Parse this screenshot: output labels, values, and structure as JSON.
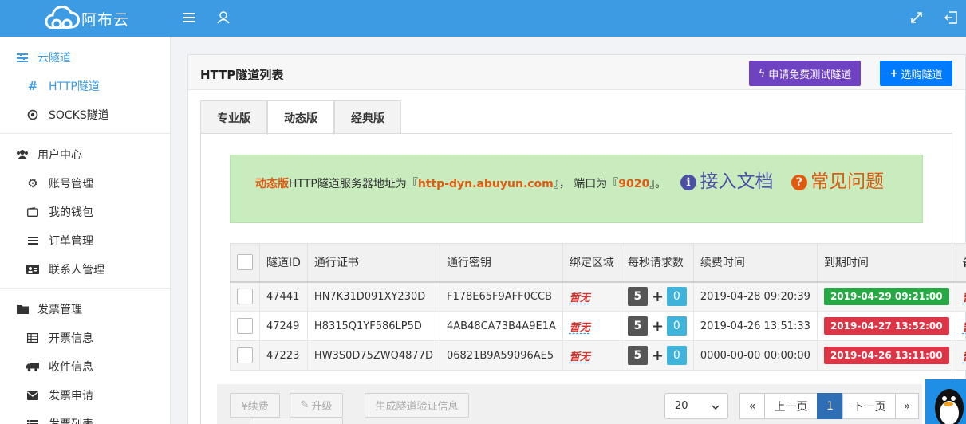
{
  "header": {
    "logo_text": "阿布云"
  },
  "sidebar": {
    "groups": [
      {
        "items": [
          {
            "label": "云隧道",
            "level": "top",
            "icon": "sliders-icon",
            "active": true
          },
          {
            "label": "HTTP隧道",
            "level": "sub",
            "icon": "hash-icon",
            "active": true
          },
          {
            "label": "SOCKS隧道",
            "level": "sub",
            "icon": "dot-circle-icon"
          }
        ]
      },
      {
        "items": [
          {
            "label": "用户中心",
            "level": "top",
            "icon": "users-icon"
          },
          {
            "label": "账号管理",
            "level": "sub",
            "icon": "gear-icon"
          },
          {
            "label": "我的钱包",
            "level": "sub",
            "icon": "wallet-icon"
          },
          {
            "label": "订单管理",
            "level": "sub",
            "icon": "list-icon"
          },
          {
            "label": "联系人管理",
            "level": "sub",
            "icon": "id-card-icon"
          }
        ]
      },
      {
        "items": [
          {
            "label": "发票管理",
            "level": "top",
            "icon": "folder-icon"
          },
          {
            "label": "开票信息",
            "level": "sub",
            "icon": "table-icon"
          },
          {
            "label": "收件信息",
            "level": "sub",
            "icon": "truck-icon"
          },
          {
            "label": "发票申请",
            "level": "sub",
            "icon": "envelope-icon"
          },
          {
            "label": "发票列表",
            "level": "sub",
            "icon": "list-ul-icon"
          }
        ]
      }
    ]
  },
  "panel": {
    "title": "HTTP隧道列表",
    "trial_button": "申请免费测试隧道",
    "buy_button": "选购隧道"
  },
  "tabs": [
    {
      "label": "专业版"
    },
    {
      "label": "动态版",
      "active": true
    },
    {
      "label": "经典版"
    }
  ],
  "notice": {
    "edition": "动态版",
    "text1": "HTTP隧道服务器地址为『",
    "host": "http-dyn.abuyun.com",
    "text2": "』， 端口为『",
    "port": "9020",
    "text3": "』。",
    "doc_link": "接入文档",
    "faq_link": "常见问题"
  },
  "table": {
    "headers": [
      "",
      "隧道ID",
      "通行证书",
      "通行密钥",
      "绑定区域",
      "每秒请求数",
      "续费时间",
      "到期时间",
      "备注"
    ],
    "rows": [
      {
        "id": "47441",
        "cert": "HN7K31D091XY230D",
        "key": "F178E65F9AFF0CCB",
        "region": "暂无",
        "qps": "5",
        "qps_add": "0",
        "renew": "2019-04-28 09:20:39",
        "expire": "2019-04-29 09:21:00",
        "expire_status": "ok",
        "note": "暂无"
      },
      {
        "id": "47249",
        "cert": "H8315Q1YF586LP5D",
        "key": "4AB48CA73B4A9E1A",
        "region": "暂无",
        "qps": "5",
        "qps_add": "0",
        "renew": "2019-04-26 13:51:33",
        "expire": "2019-04-27 13:52:00",
        "expire_status": "bad",
        "note": "暂无"
      },
      {
        "id": "47223",
        "cert": "HW3S0D75ZWQ4877D",
        "key": "06821B9A59096AE5",
        "region": "暂无",
        "qps": "5",
        "qps_add": "0",
        "renew": "0000-00-00 00:00:00",
        "expire": "2019-04-26 13:11:00",
        "expire_status": "bad",
        "note": "暂无"
      }
    ]
  },
  "footer": {
    "renew_button": "¥续费",
    "upgrade_button": "升级",
    "gen_button": "生成隧道验证信息",
    "page_size": "20",
    "pager": {
      "first": "«",
      "prev": "上一页",
      "current": "1",
      "next": "下一页",
      "last": "»"
    }
  },
  "colors": {
    "header": "#3c9be3",
    "trial": "#6f42c1",
    "buy": "#007bff",
    "ok": "#28a745",
    "bad": "#dc3545",
    "notice_bg": "#c9ecbf"
  }
}
